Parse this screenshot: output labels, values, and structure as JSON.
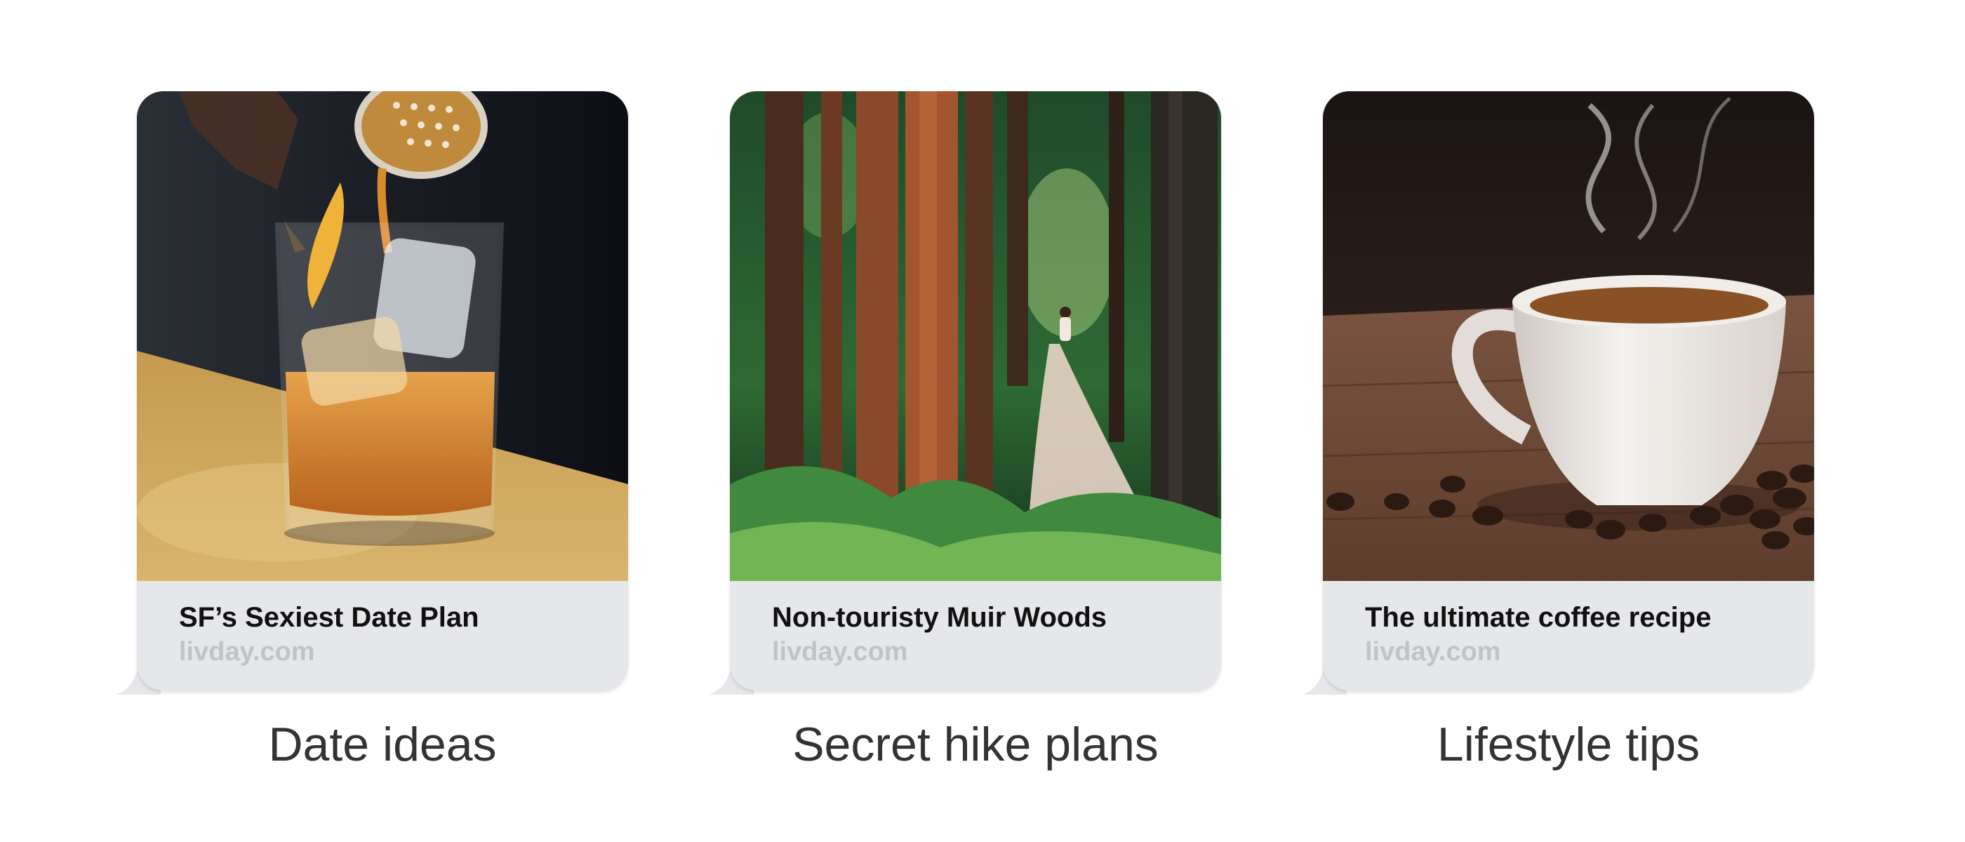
{
  "cards": [
    {
      "title": "SF’s Sexiest Date Plan",
      "domain": "livday.com",
      "caption": "Date ideas",
      "image": "whiskey-cocktail-photo"
    },
    {
      "title": "Non-touristy Muir Woods",
      "domain": "livday.com",
      "caption": "Secret hike plans",
      "image": "redwood-forest-trail-photo"
    },
    {
      "title": "The ultimate coffee recipe",
      "domain": "livday.com",
      "caption": "Lifestyle tips",
      "image": "steaming-coffee-cup-photo"
    }
  ],
  "colors": {
    "bubble": "#e6e7ea",
    "title_text": "#111111",
    "domain_text": "#c2c3c7",
    "caption_text": "#333333"
  }
}
